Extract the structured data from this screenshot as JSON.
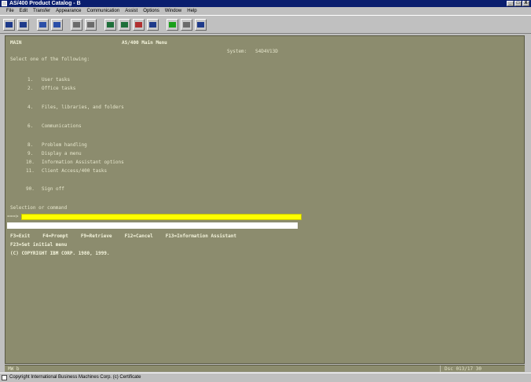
{
  "window": {
    "title": "AS/400 Product Catalog - B",
    "controls": [
      "_",
      "□",
      "X"
    ]
  },
  "menu": [
    "File",
    "Edit",
    "Transfer",
    "Appearance",
    "Communication",
    "Assist",
    "Options",
    "Window",
    "Help"
  ],
  "toolbar": [
    {
      "icon": "print-icon",
      "color": "#1e3a8a"
    },
    {
      "icon": "print-screen-icon",
      "color": "#1e3a8a"
    },
    {
      "icon": "send-icon",
      "color": "#2b4fa8"
    },
    {
      "icon": "receive-icon",
      "color": "#2b4fa8"
    },
    {
      "icon": "copy-icon",
      "color": "#6b6b6b"
    },
    {
      "icon": "paste-icon",
      "color": "#6b6b6b"
    },
    {
      "icon": "macro-icon",
      "color": "#1e6f3a"
    },
    {
      "icon": "record-icon",
      "color": "#1e6f3a"
    },
    {
      "icon": "color-icon",
      "color": "#b03030"
    },
    {
      "icon": "keypad-icon",
      "color": "#1e3a8a"
    },
    {
      "icon": "run-icon",
      "color": "#1aa01a"
    },
    {
      "icon": "disconnect-icon",
      "color": "#6b6b6b"
    },
    {
      "icon": "help-icon",
      "color": "#1e3a8a"
    }
  ],
  "screen": {
    "id": "MAIN",
    "heading": "AS/400 Main Menu",
    "system_label": "System:",
    "system": "S4D4V13D",
    "prompt": "Select one of the following:",
    "options": [
      {
        "num": "1.",
        "label": "User tasks"
      },
      {
        "num": "2.",
        "label": "Office tasks"
      },
      {
        "num": "4.",
        "label": "Files, libraries, and folders"
      },
      {
        "num": "6.",
        "label": "Communications"
      },
      {
        "num": "8.",
        "label": "Problem handling"
      },
      {
        "num": "9.",
        "label": "Display a menu"
      },
      {
        "num": "10.",
        "label": "Information Assistant options"
      },
      {
        "num": "11.",
        "label": "Client Access/400 tasks"
      },
      {
        "num": "90.",
        "label": "Sign off"
      }
    ],
    "selection_label": "Selection or command",
    "input_prompt": "===>",
    "input_value": "",
    "fkeys": [
      "F3=Exit",
      "F4=Prompt",
      "F9=Retrieve",
      "F12=Cancel",
      "F13=Information Assistant"
    ],
    "fkeys2": "F23=Set initial menu",
    "copyright": "(C) COPYRIGHT IBM CORP. 1980, 1999."
  },
  "status": {
    "left": "MW  b",
    "right": "Dsc 013/17   30"
  },
  "bottom_bar": "Copyright International Business Machines Corp. (c) Certificate"
}
